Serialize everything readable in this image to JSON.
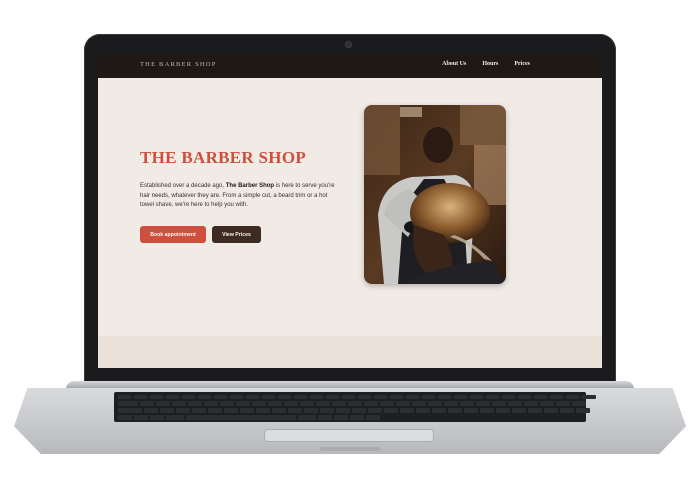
{
  "nav": {
    "brand": "THE BARBER SHOP",
    "links": [
      "About Us",
      "Hours",
      "Prices"
    ]
  },
  "hero": {
    "title": "THE BARBER SHOP",
    "description": {
      "part1": "Established over a decade ago, ",
      "bold": "The Barber Shop",
      "part2": " is here to serve you're hair needs, whatever they are. From a simple cut, a beard trim or a hot towel shave, we're here to help you with."
    },
    "buttons": {
      "primary": "Book appointment",
      "secondary": "View Prices"
    }
  },
  "colors": {
    "accent": "#cf4f3f",
    "nav_bg": "#1f1915",
    "hero_bg": "#f1ebe6",
    "secondary_button": "#3d2b23"
  }
}
